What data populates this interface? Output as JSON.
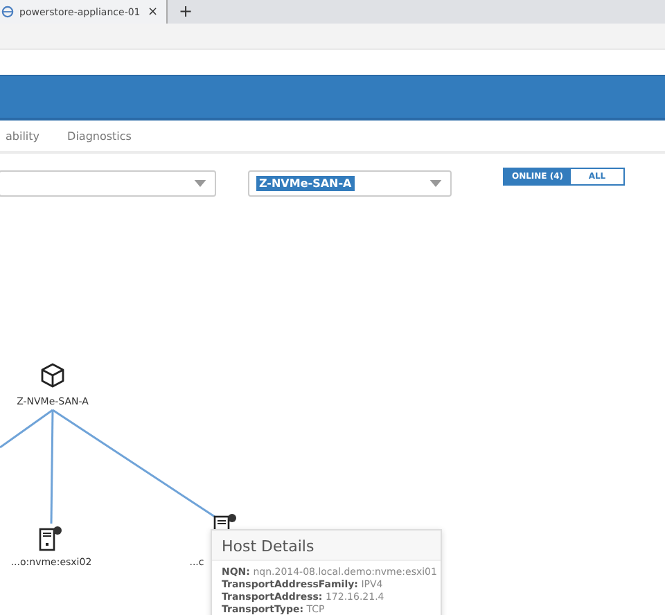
{
  "browser": {
    "tab_title": "powerstore-appliance-01",
    "close_glyph": "×",
    "new_tab_glyph": "+"
  },
  "nav_tabs": [
    {
      "label": "ability",
      "selected": false
    },
    {
      "label": "Diagnostics",
      "selected": false
    }
  ],
  "dropdown": {
    "value": "Z-NVMe-SAN-A"
  },
  "status_toggle": [
    {
      "label": "ONLINE (4)",
      "selected": true
    },
    {
      "label": "ALL",
      "selected": false
    }
  ],
  "topology": {
    "nodes": [
      {
        "kind": "switch",
        "label": "Z-NVMe-SAN-A"
      },
      {
        "kind": "host",
        "label": "...o:nvme:esxi02"
      },
      {
        "kind": "host",
        "label": "...c"
      }
    ]
  },
  "tooltip": {
    "title": "Host Details",
    "lines": [
      "**NQN:** nqn.2014-08.local.demo:nvme:esxi01",
      "**TransportAddressFamily:** IPV4",
      "**TransportAddress:** 172.16.21.4",
      "**TransportType:** TCP"
    ]
  }
}
